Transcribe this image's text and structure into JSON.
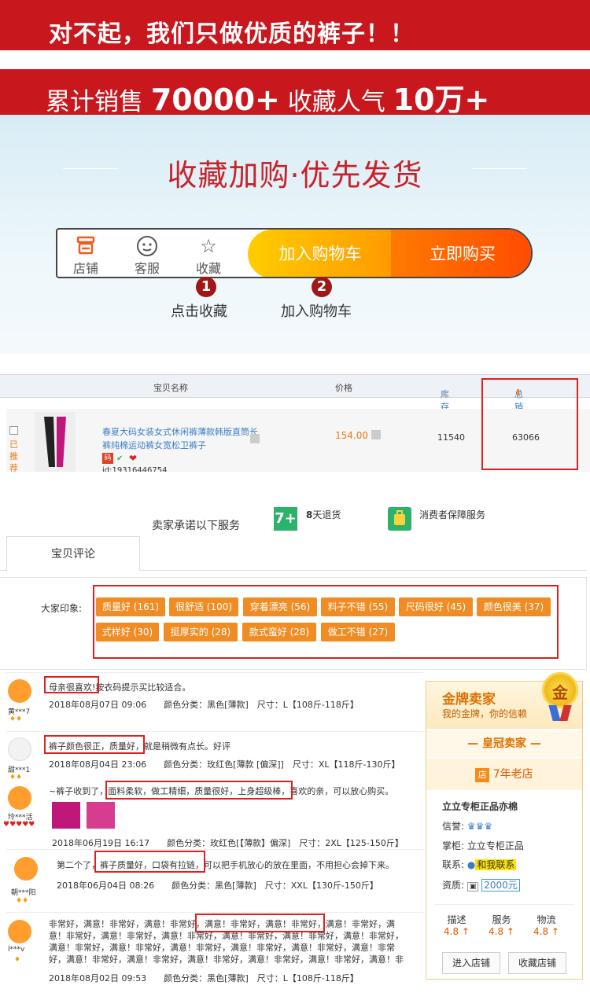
{
  "banner1": {
    "text": "对不起，我们只做优质的裤子！！"
  },
  "banner2": {
    "pre": "累计销售 ",
    "sales": "70000+",
    "mid": " 收藏人气 ",
    "fav": "10万+"
  },
  "hero": {
    "title": "收藏加购·优先发货",
    "bar": {
      "shop": "店铺",
      "service": "客服",
      "favorite": "收藏",
      "cart": "加入购物车",
      "buy": "立即购买"
    },
    "steps": [
      {
        "num": "1",
        "label": "点击收藏"
      },
      {
        "num": "2",
        "label": "加入购物车"
      }
    ]
  },
  "table": {
    "headers": {
      "name": "宝贝名称",
      "price": "价格",
      "stock": "库存",
      "sales": "总销量"
    },
    "row": {
      "title": "春夏大码女装女式休闲裤薄款韩版直筒长裤纯棉运动裤女宽松卫裤子",
      "price": "154.00",
      "stock": "11540",
      "sales": "63066",
      "id": "id:19316446754",
      "recommend": "已推荐",
      "badge": "码"
    }
  },
  "services": {
    "heading": "卖家承诺以下服务",
    "refund_days": "8",
    "refund": "天退货",
    "guarantee": "消费者保障服务"
  },
  "tab": {
    "label": "宝贝评论"
  },
  "impression": {
    "label": "大家印象:",
    "tags": [
      "质量好 (161)",
      "很舒适 (100)",
      "穿着漂亮 (56)",
      "料子不错 (55)",
      "尺码很好 (45)",
      "颜色很美 (37)",
      "式样好 (30)",
      "挺厚实的 (28)",
      "款式蛮好 (28)",
      "做工不错 (27)"
    ]
  },
  "reviews": [
    {
      "nick": "黄***7",
      "hl": "母亲很喜欢!",
      "rest": "按衣码提示买比较适合。",
      "meta": "2018年08月07日 09:06　　颜色分类：黑色[薄款]　尺寸：L【108斤-118斤】"
    },
    {
      "nick": "甜***1",
      "hl": "裤子颜色很正，质量好，",
      "rest": "就是稍微有点长。好评",
      "meta": "2018年08月04日 23:06　　颜色分类：玫红色[薄款 [偏深]]　尺寸：XL【118斤-130斤】"
    },
    {
      "nick": "玲***活",
      "pre": "~裤子收到了，",
      "hl": "面料柔软，做工精细，质量很好，上身超级棒，",
      "rest": "喜欢的亲，可以放心购买。",
      "meta": "2018年06月19日 16:17　　颜色分类：玫红色[【薄款】偏深]　尺寸：2XL【125-150斤】"
    },
    {
      "nick": "朝***阳",
      "pre": "第二个了，",
      "hl": "裤子质量好，口袋有拉链，",
      "rest": "可以把手机放心的放在里面，不用担心会掉下来。",
      "meta": "2018年06月04日 08:26　　颜色分类：黑色[薄款]　尺寸：XXL【130斤-150斤】"
    },
    {
      "nick": "l***v",
      "pre": "非常好，满意！非常好，满意！非常好，",
      "hl": "满意！非常好，满意！非常好，",
      "rest": "满意！非常好，满意！非常好，满意！非常好，满意！非常好，满意！非常好，满意！非常好，满意！非常好，满意！非常好，满意！非常好，满意！非常好，满意！非常好，满意！非常好，满意！非常好，满意！非常好，满意！非常好，满意！非常好，满意！非常好，满意！非常好，满意！非常好，满意！非常好，满意！非常好，满意！",
      "meta": "2018年08月02日 09:53　　颜色分类：黑色[薄款]　尺寸：L【108斤-118斤】"
    }
  ],
  "seller": {
    "gold_title": "金牌卖家",
    "gold_sub": "我的金牌，你的信赖",
    "medal": "金",
    "crown": "皇冠卖家",
    "years_icon": "店",
    "years": "7年老店",
    "shop_name": "立立专柜正品亦棉",
    "rating_label": "信誉:",
    "keeper_label": "掌柜:",
    "keeper": "立立专柜正品",
    "contact_label": "联系:",
    "contact": "和我联系",
    "qual_label": "资质:",
    "deposit": "2000元",
    "scores": [
      {
        "label": "描述",
        "value": "4.8"
      },
      {
        "label": "服务",
        "value": "4.8"
      },
      {
        "label": "物流",
        "value": "4.8"
      }
    ],
    "enter": "进入店铺",
    "collect": "收藏店铺"
  },
  "colors": {
    "red": "#c9171e",
    "orange": "#f08c24",
    "blue": "#3a7fc8"
  }
}
